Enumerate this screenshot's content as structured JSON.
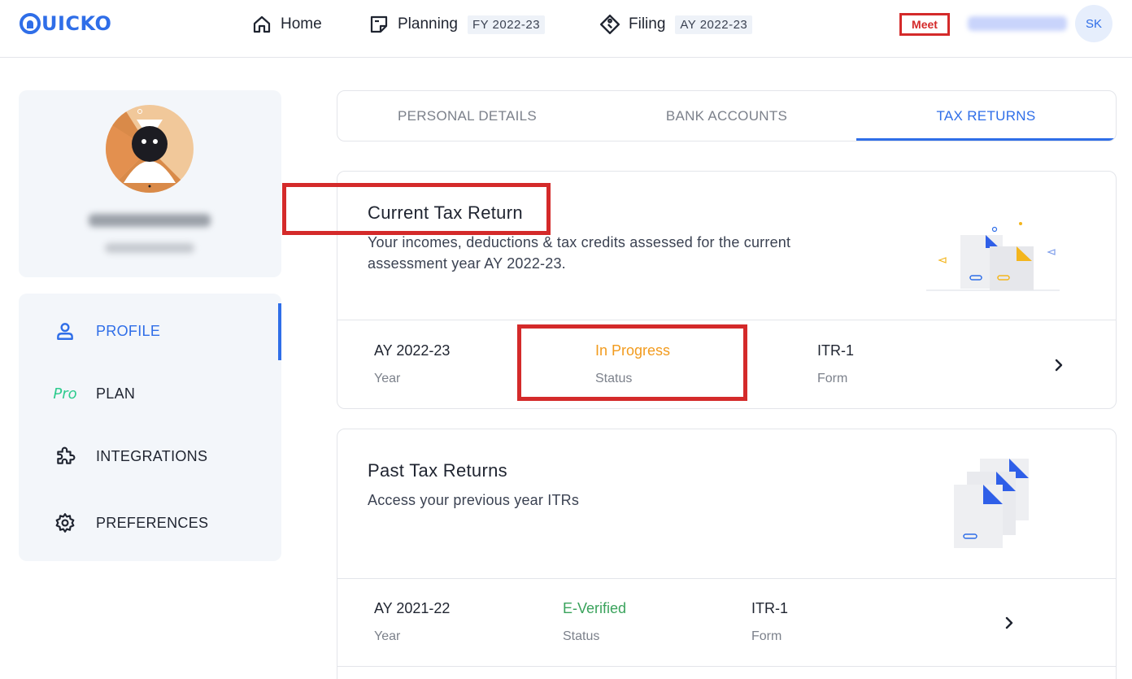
{
  "brand": {
    "logo_text": "UICKO"
  },
  "nav": {
    "home": "Home",
    "planning": "Planning",
    "planning_badge": "FY 2022-23",
    "filing": "Filing",
    "filing_badge": "AY 2022-23"
  },
  "header": {
    "meet_label": "Meet",
    "avatar_initials": "SK"
  },
  "sidebar": {
    "items": [
      {
        "label": "PROFILE",
        "icon": "person-icon",
        "active": true
      },
      {
        "label": "PLAN",
        "icon_text": "Pro"
      },
      {
        "label": "INTEGRATIONS",
        "icon": "puzzle-icon"
      },
      {
        "label": "PREFERENCES",
        "icon": "gear-icon"
      }
    ]
  },
  "tabs": [
    {
      "label": "PERSONAL DETAILS"
    },
    {
      "label": "BANK ACCOUNTS"
    },
    {
      "label": "TAX RETURNS",
      "active": true
    }
  ],
  "current_return": {
    "title": "Current Tax Return",
    "description": "Your incomes, deductions & tax credits assessed for the current assessment year AY 2022-23.",
    "year_value": "AY 2022-23",
    "year_label": "Year",
    "status_value": "In Progress",
    "status_label": "Status",
    "form_value": "ITR-1",
    "form_label": "Form"
  },
  "past_returns": {
    "title": "Past Tax Returns",
    "description": "Access your previous year ITRs",
    "rows": [
      {
        "year_value": "AY 2021-22",
        "year_label": "Year",
        "status_value": "E-Verified",
        "status_label": "Status",
        "form_value": "ITR-1",
        "form_label": "Form"
      }
    ]
  },
  "colors": {
    "accent": "#2f6ee8",
    "in_progress": "#f29b1e",
    "verified": "#3aa35c",
    "annotation": "#d42a2a"
  }
}
